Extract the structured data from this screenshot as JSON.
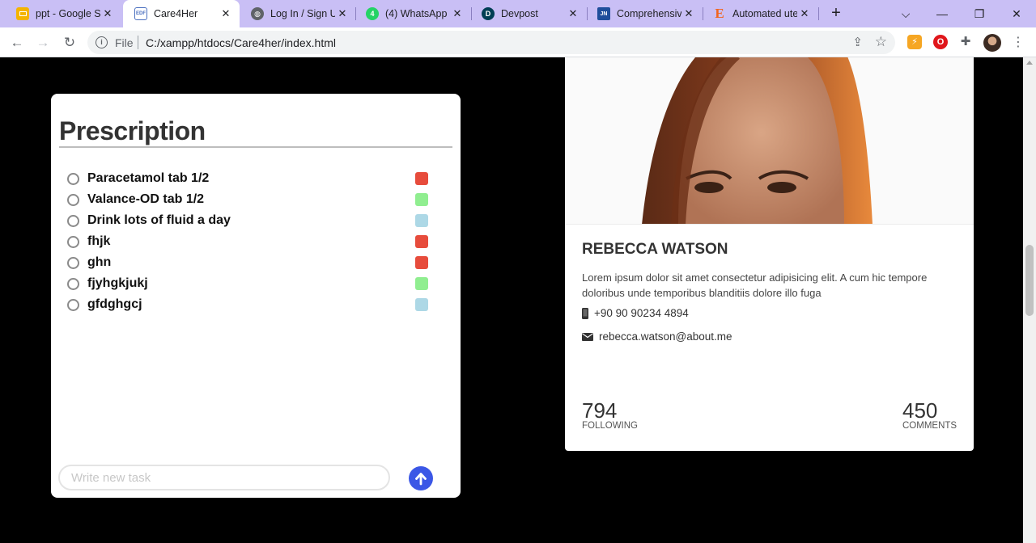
{
  "browser": {
    "tabs": [
      {
        "title": "ppt - Google Sl",
        "icon": "slides-icon",
        "color": "#f4b400"
      },
      {
        "title": "Care4Her",
        "icon": "pdf-file-icon",
        "color": "#4a6fbf",
        "active": true
      },
      {
        "title": "Log In / Sign U",
        "icon": "globe-icon",
        "color": "#5f6368"
      },
      {
        "title": "(4) WhatsApp",
        "icon": "whatsapp-icon",
        "color": "#25d366"
      },
      {
        "title": "Devpost",
        "icon": "devpost-icon",
        "color": "#003e54"
      },
      {
        "title": "Comprehensive",
        "icon": "jstor-icon",
        "color": "#1f4e9b"
      },
      {
        "title": "Automated ute",
        "icon": "etsy-icon",
        "color": "#f1641e"
      }
    ],
    "file_label": "File",
    "url": "C:/xampp/htdocs/Care4her/index.html"
  },
  "prescription": {
    "title": "Prescription",
    "items": [
      {
        "label": "Paracetamol tab 1/2",
        "color": "#e74c3c"
      },
      {
        "label": "Valance-OD tab 1/2",
        "color": "#90ee90"
      },
      {
        "label": "Drink lots of fluid a day",
        "color": "#add8e6"
      },
      {
        "label": "fhjk",
        "color": "#e74c3c"
      },
      {
        "label": "ghn",
        "color": "#e74c3c"
      },
      {
        "label": "fjyhgkjukj",
        "color": "#90ee90"
      },
      {
        "label": "gfdghgcj",
        "color": "#add8e6"
      }
    ],
    "input_placeholder": "Write new task",
    "send_color": "#3b57e6"
  },
  "profile": {
    "name": "REBECCA WATSON",
    "bio": "Lorem ipsum dolor sit amet consectetur adipisicing elit. A cum hic tempore doloribus unde temporibus blanditiis dolore illo fuga",
    "phone": "+90 90 90234 4894",
    "email": "rebecca.watson@about.me",
    "stats": [
      {
        "value": "794",
        "label": "FOLLOWING"
      },
      {
        "value": "450",
        "label": "COMMENTS"
      }
    ]
  }
}
